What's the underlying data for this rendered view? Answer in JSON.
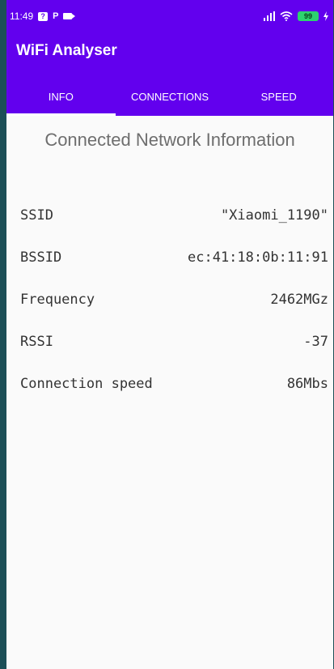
{
  "status_bar": {
    "time": "11:49",
    "icons": [
      "sim-icon",
      "parking-app-icon",
      "video-icon"
    ],
    "p_letter": "P",
    "signal_icon": "signal-icon",
    "wifi_icon": "wifi-icon",
    "battery": "99",
    "charging_icon": "charging-icon"
  },
  "app": {
    "title": "WiFi Analyser",
    "accent_color": "#6200ee"
  },
  "tabs": [
    {
      "label": "INFO",
      "active": true
    },
    {
      "label": "CONNECTIONS",
      "active": false
    },
    {
      "label": "SPEED",
      "active": false
    }
  ],
  "main": {
    "section_title": "Connected Network Information",
    "rows": [
      {
        "label": "SSID",
        "value": "\"Xiaomi_1190\""
      },
      {
        "label": "BSSID",
        "value": "ec:41:18:0b:11:91"
      },
      {
        "label": "Frequency",
        "value": "2462MGz"
      },
      {
        "label": "RSSI",
        "value": "-37"
      },
      {
        "label": "Connection speed",
        "value": "86Mbs"
      }
    ]
  }
}
